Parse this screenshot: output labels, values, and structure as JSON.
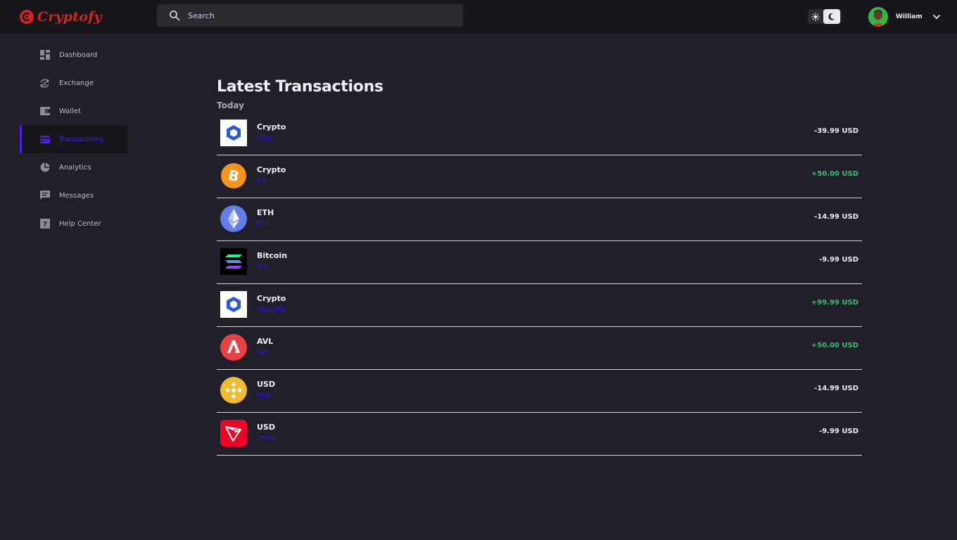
{
  "app": {
    "name": "Cryptofy"
  },
  "search": {
    "placeholder": "Search",
    "value": ""
  },
  "user": {
    "name": "William"
  },
  "sidebar": {
    "items": [
      {
        "label": "Dashboard",
        "icon": "dashboard-icon"
      },
      {
        "label": "Exchange",
        "icon": "exchange-icon"
      },
      {
        "label": "Wallet",
        "icon": "wallet-icon"
      },
      {
        "label": "Transactions",
        "icon": "card-icon",
        "active": true
      },
      {
        "label": "Analytics",
        "icon": "pie-chart-icon"
      },
      {
        "label": "Messages",
        "icon": "message-icon"
      },
      {
        "label": "Help Center",
        "icon": "help-icon"
      }
    ]
  },
  "main": {
    "title": "Latest Transactions",
    "section": "Today",
    "transactions": [
      {
        "name": "Crypto",
        "sub": "LINK",
        "amount": "-39.99 USD",
        "icon": "chainlink-icon"
      },
      {
        "name": "Crypto",
        "sub": "BTC",
        "amount": "+50.00 USD",
        "icon": "bitcoin-icon"
      },
      {
        "name": "ETH",
        "sub": "ETH",
        "amount": "-14.99 USD",
        "icon": "ethereum-icon"
      },
      {
        "name": "Bitcoin",
        "sub": "SOL",
        "amount": "-9.99 USD",
        "icon": "solana-icon"
      },
      {
        "name": "Crypto",
        "sub": "Chainlink",
        "amount": "+99.99 USD",
        "icon": "chainlink-icon"
      },
      {
        "name": "AVL",
        "sub": "AVX",
        "amount": "+50.00 USD",
        "icon": "avalanche-icon"
      },
      {
        "name": "USD",
        "sub": "BNB",
        "amount": "-14.99 USD",
        "icon": "binance-icon"
      },
      {
        "name": "USD",
        "sub": "TRON",
        "amount": "-9.99 USD",
        "icon": "tron-icon"
      }
    ]
  },
  "colors": {
    "accent": "#4b1cf0",
    "positive": "#3bbf70",
    "brand": "#d4241f",
    "background": "#211f2a",
    "topbar": "#16161b"
  }
}
